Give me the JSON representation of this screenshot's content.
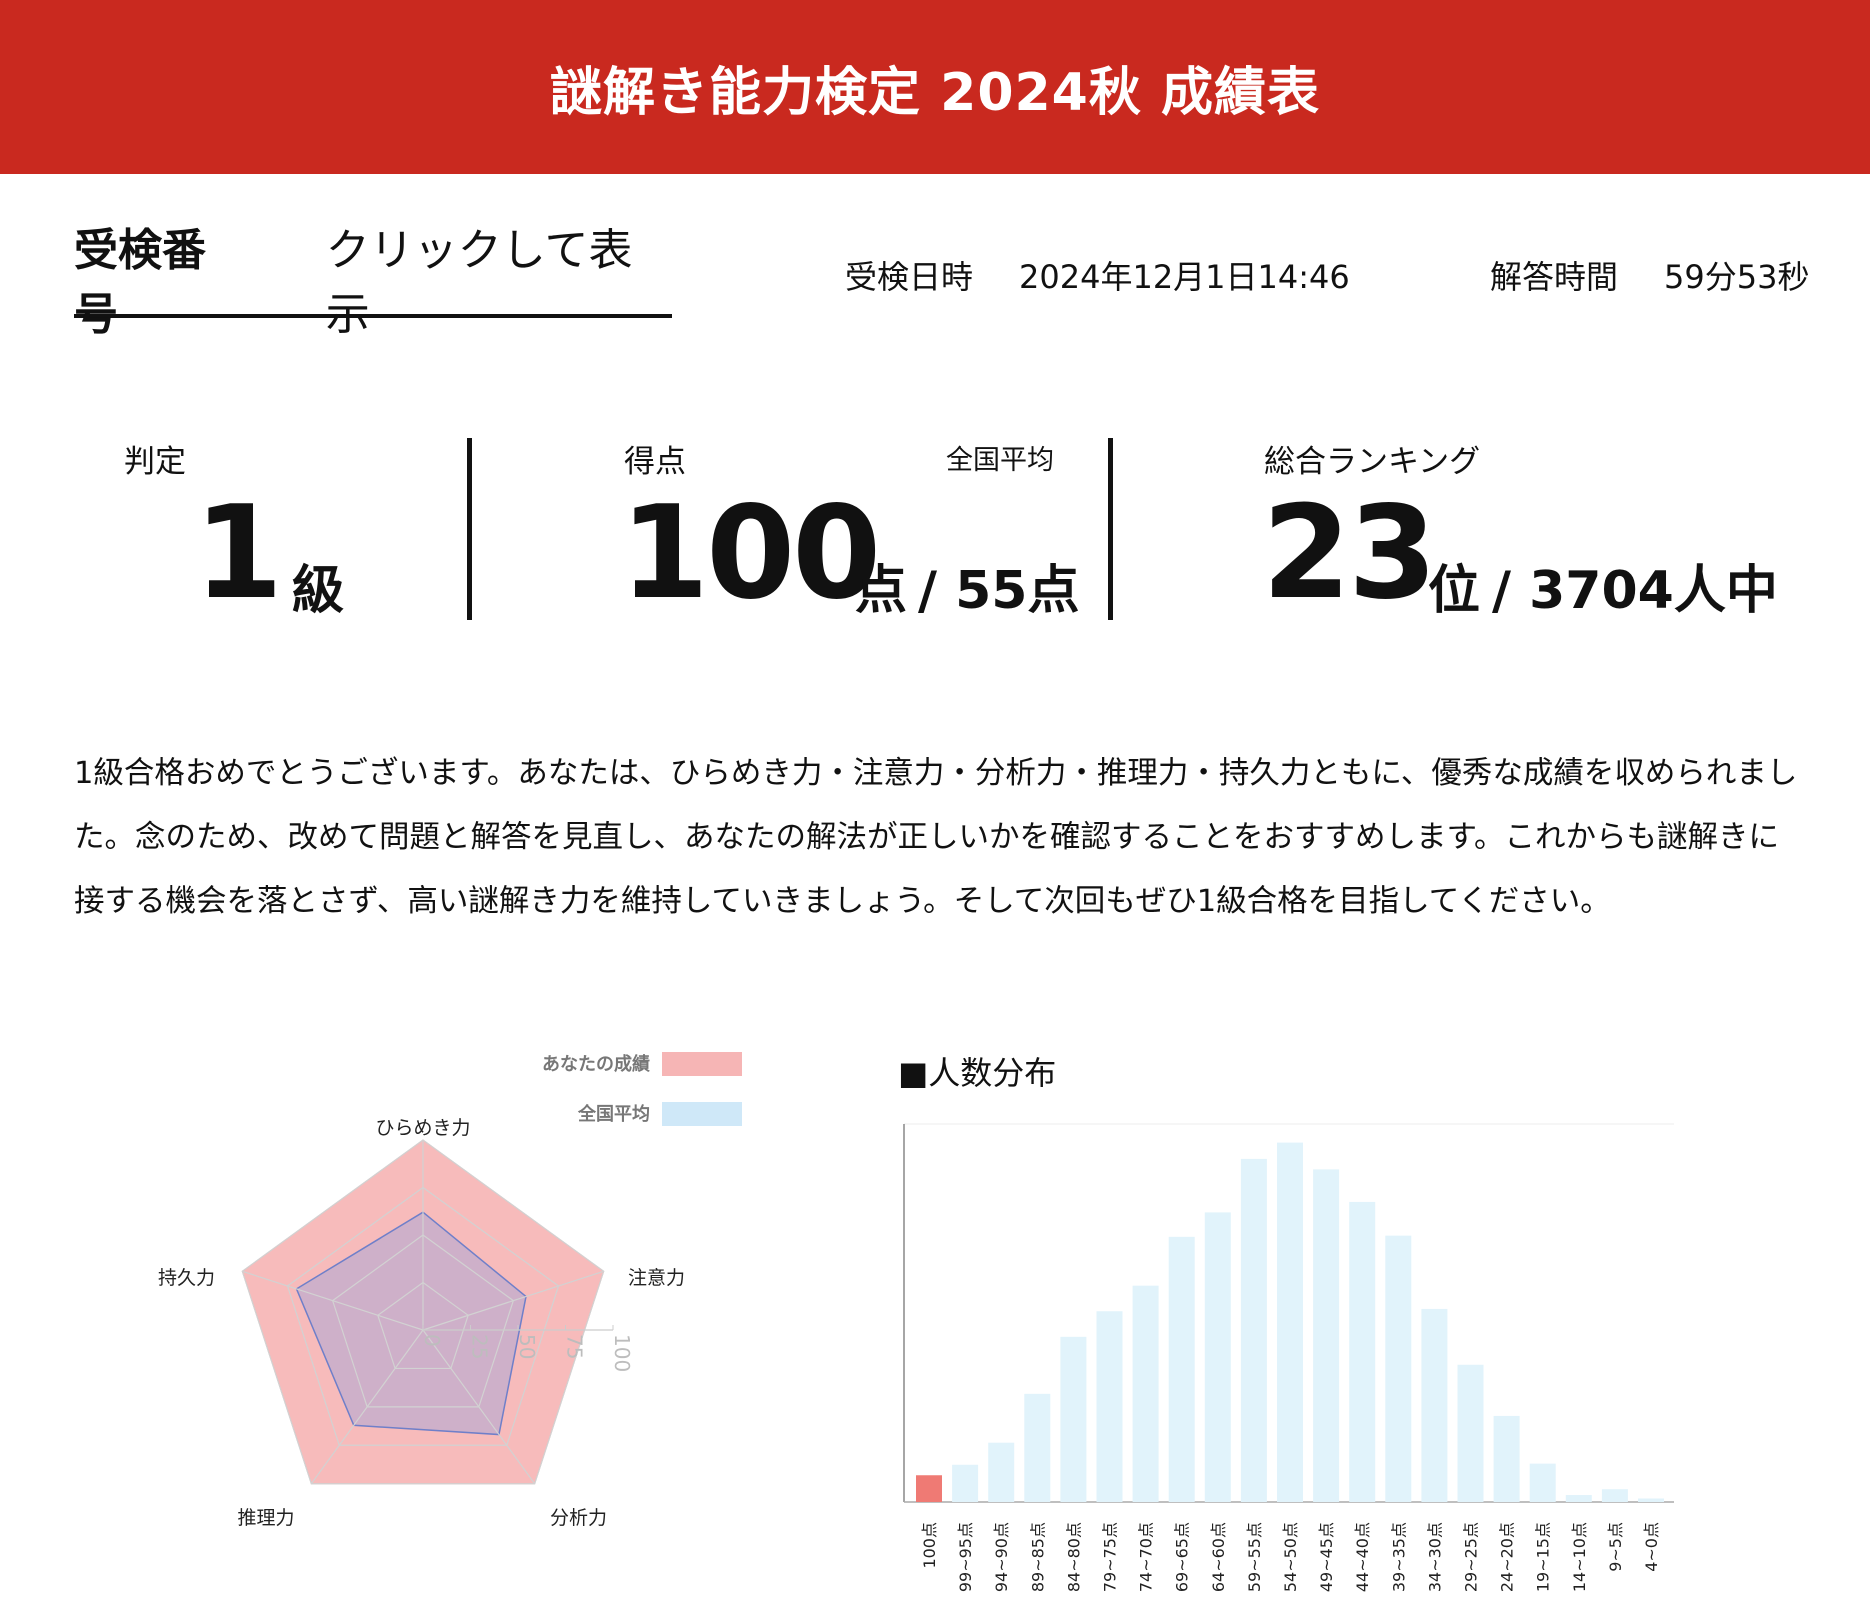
{
  "header": {
    "title": "謎解き能力検定 2024秋 成績表"
  },
  "exam_number": {
    "label": "受検番号",
    "value": "クリックして表示"
  },
  "exam_date": {
    "label": "受検日時",
    "value": "2024年12月1日14:46"
  },
  "answer_time": {
    "label": "解答時間",
    "value": "59分53秒"
  },
  "judgement": {
    "label": "判定",
    "value": "1",
    "unit": "級"
  },
  "score": {
    "label": "得点",
    "value": "100",
    "unit": "点",
    "average_label": "全国平均",
    "average_value": "/ 55点"
  },
  "ranking": {
    "label": "総合ランキング",
    "value": "23",
    "unit": "位",
    "total": "/ 3704人中"
  },
  "message": "1級合格おめでとうございます。あなたは、ひらめき力・注意力・分析力・推理力・持久力ともに、優秀な成績を収められました。念のため、改めて問題と解答を見直し、あなたの解法が正しいかを確認することをおすすめします。これからも謎解きに接する機会を落とさず、高い謎解き力を維持していきましょう。そして次回もぜひ1級合格を目指してください。",
  "colors": {
    "brand": "#c9291f",
    "you": "#f5b7b7",
    "average": "#cfe8f8",
    "highlight_bar": "#ef7a74",
    "bar": "#e1f3fb"
  },
  "chart_data": [
    {
      "type": "radar",
      "axes": [
        "ひらめき力",
        "注意力",
        "分析力",
        "推理力",
        "持久力"
      ],
      "ticks": [
        "0",
        "25",
        "50",
        "75",
        "100"
      ],
      "range": [
        0,
        100
      ],
      "legend_position": "top-right",
      "series": [
        {
          "name": "あなたの成績",
          "values": [
            100,
            100,
            100,
            100,
            100
          ],
          "color": "#f5b7b7"
        },
        {
          "name": "全国平均",
          "values": [
            62,
            57,
            68,
            62,
            70
          ],
          "color": "#cfe8f8"
        }
      ]
    },
    {
      "type": "bar",
      "title": "■人数分布",
      "categories": [
        "100点",
        "99~95点",
        "94~90点",
        "89~85点",
        "84~80点",
        "79~75点",
        "74~70点",
        "69~65点",
        "64~60点",
        "59~55点",
        "54~50点",
        "49~45点",
        "44~40点",
        "39~35点",
        "34~30点",
        "29~25点",
        "24~20点",
        "19~15点",
        "14~10点",
        "9~5点",
        "4~0点"
      ],
      "values": [
        23,
        32,
        51,
        93,
        142,
        164,
        186,
        228,
        249,
        295,
        309,
        286,
        258,
        229,
        166,
        118,
        74,
        33,
        6,
        11,
        3
      ],
      "highlight_index": 0
    }
  ]
}
